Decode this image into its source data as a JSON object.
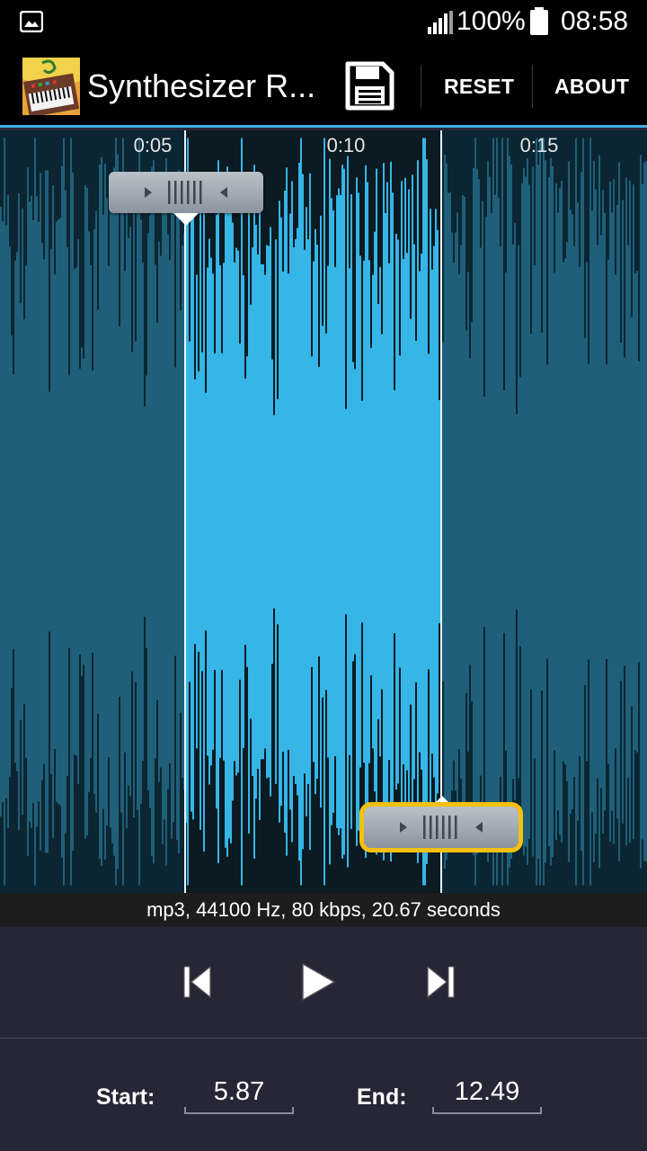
{
  "status_bar": {
    "battery_percent": "100%",
    "time": "08:58",
    "icons": [
      "gallery-icon",
      "signal-icon",
      "battery-icon"
    ]
  },
  "action_bar": {
    "title": "Synthesizer R...",
    "reset_label": "RESET",
    "about_label": "ABOUT",
    "icons": [
      "app-logo",
      "save-icon"
    ]
  },
  "waveform": {
    "time_labels": [
      "0:05",
      "0:10",
      "0:15"
    ],
    "selection_start_seconds": 5.87,
    "selection_end_seconds": 12.49,
    "colors": {
      "background": "#0b2632",
      "waveform": "#1f5f79",
      "selected_background": "#0c1a22",
      "selected_waveform": "#35b6e6",
      "active_handle_outline": "#f3c10f"
    }
  },
  "file_info": "mp3, 44100 Hz, 80 kbps, 20.67 seconds",
  "transport": {
    "icons": [
      "skip-back-icon",
      "play-icon",
      "skip-forward-icon"
    ]
  },
  "range": {
    "start_label": "Start:",
    "start_value": "5.87",
    "end_label": "End:",
    "end_value": "12.49"
  }
}
